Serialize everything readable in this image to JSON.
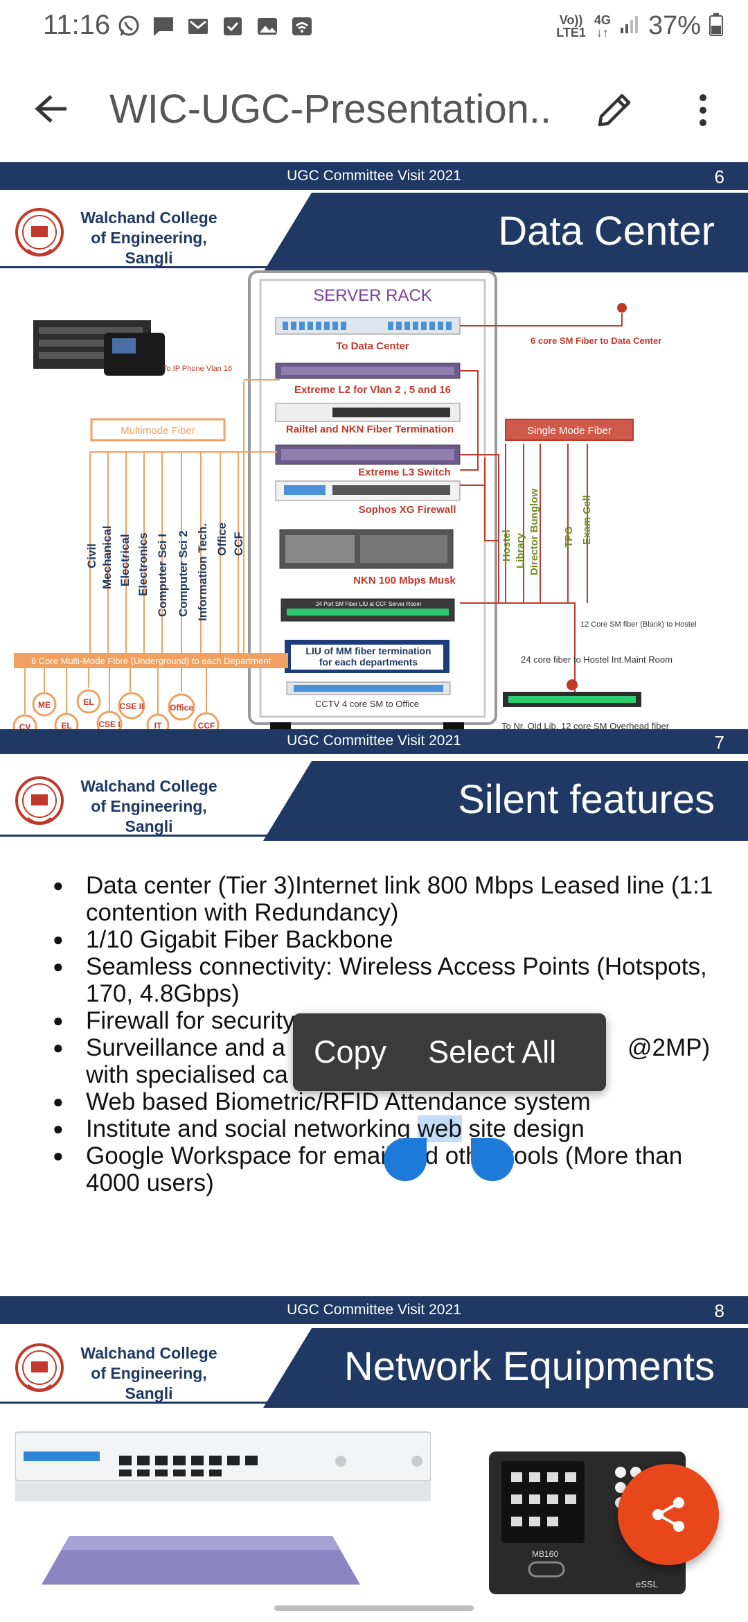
{
  "status_bar": {
    "time": "11:16",
    "network_top": "Vo))",
    "network_bottom": "LTE1",
    "net_type": "4G",
    "battery": "37%"
  },
  "app_bar": {
    "title": "WIC-UGC-Presentation...."
  },
  "slides": {
    "s6": {
      "topbar": "UGC Committee Visit 2021",
      "number": "6",
      "college_line1": "Walchand College",
      "college_line2": "of Engineering,",
      "college_line3": "Sangli",
      "title": "Data Center",
      "rack": {
        "heading": "SERVER RACK",
        "labels": {
          "to_ip_phone": "To IP Phone Vlan 16",
          "to_data_center": "To Data Center",
          "sm_fiber_dc": "6 core SM Fiber to Data Center",
          "extreme_l2": "Extreme L2 for Vlan 2 , 5 and 16",
          "railtel": "Railtel and NKN Fiber Termination",
          "extreme_l3": "Extreme L3 Switch",
          "sophos": "Sophos XG Firewall",
          "nkn": "NKN 100 Mbps Musk",
          "port_liu": "24 Port SM Fiber LIU at CCF Server Room",
          "liu_mm_1": "LIU of MM fiber termination",
          "liu_mm_2": "for each departments",
          "cctv": "CCTV  4 core SM  to Office",
          "multimode": "Multimode Fiber",
          "singlemode": "Single Mode Fiber",
          "mm_underground": "6 Core Multi-Mode Fibre (Underground) to each Department",
          "hostel_blank": "12 Core SM fiber (Blank) to Hostel",
          "hostel_int": "24 core fiber to Hostel Int.Maint Room",
          "old_lib": "To Nr. Old Lib. 12 core SM Overhead fiber"
        },
        "departments": [
          "Civil",
          "Mechanical",
          "Electrical",
          "Electronics",
          "Computer Sci I",
          "Computer Sci 2",
          "Information Tech.",
          "Office",
          "CCF"
        ],
        "sm_destinations": [
          "Hostel",
          "Library",
          "Director Bunglow",
          "TPO",
          "Exam Cell"
        ],
        "circles": [
          "CV",
          "ME",
          "EL",
          "EL",
          "CSE I",
          "CSE II",
          "IT",
          "Office",
          "CCF"
        ]
      }
    },
    "s7": {
      "topbar": "UGC Committee Visit 2021",
      "number": "7",
      "college_line1": "Walchand College",
      "college_line2": "of Engineering,",
      "college_line3": "Sangli",
      "title": "Silent features",
      "bullets": [
        "Data center (Tier 3)Internet link 800 Mbps Leased line (1:1 contention with Redundancy)",
        "1/10 Gigabit Fiber Backbone",
        "Seamless connectivity: Wireless Access Points (Hotspots, 170, 4.8Gbps)",
        "Firewall for security",
        "Surveillance and a",
        "@2MP)",
        "with specialised ca",
        "Web based Biometric/RFID Attendance system",
        "Institute and social networking ",
        "web",
        " site design",
        "Google Workspace for email and other tools (More than 4000 users)"
      ]
    },
    "s8": {
      "topbar": "UGC Committee Visit 2021",
      "number": "8",
      "college_line1": "Walchand College",
      "college_line2": "of Engineering,",
      "college_line3": "Sangli",
      "title": "Network Equipments",
      "device_label": "MB160",
      "brand_label": "eSSL"
    }
  },
  "context_menu": {
    "copy": "Copy",
    "select_all": "Select All"
  },
  "colors": {
    "navy": "#1f3864",
    "fiber_orange": "#f0a060",
    "fiber_red": "#c0392b",
    "fab": "#e8461b",
    "handle": "#1e7ad8"
  }
}
